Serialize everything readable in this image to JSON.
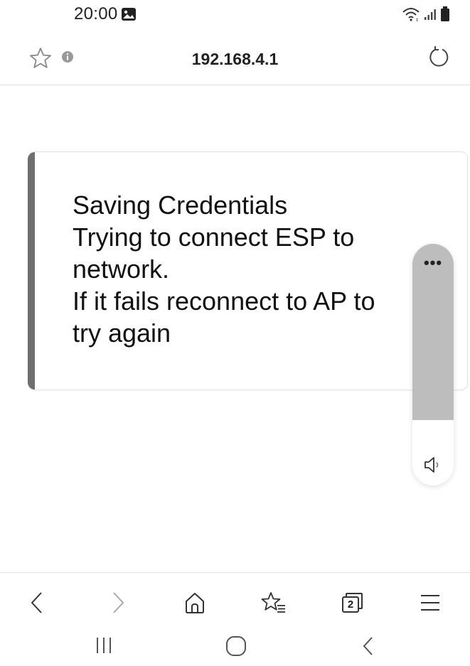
{
  "status_bar": {
    "time": "20:00",
    "icons": [
      "gallery-icon",
      "wifi-icon",
      "signal-icon",
      "battery-icon"
    ]
  },
  "browser": {
    "url": "192.168.4.1",
    "icons": [
      "star-icon",
      "info-icon",
      "reload-icon"
    ]
  },
  "card": {
    "lines": [
      "Saving Credentials",
      "Trying to connect ESP to",
      "network.",
      "If it fails reconnect to AP to",
      "try again"
    ],
    "accent_color": "#6e6e6e"
  },
  "volume_panel": {
    "more_label": "•••",
    "level": 0.73,
    "icons": [
      "speaker-icon"
    ]
  },
  "bottom_toolbar": {
    "tab_count": "2",
    "icons": [
      "back-icon",
      "forward-icon",
      "home-icon",
      "bookmarks-icon",
      "tabs-icon",
      "menu-icon"
    ]
  },
  "system_nav": {
    "icons": [
      "recents-icon",
      "home-icon",
      "back-icon"
    ]
  }
}
